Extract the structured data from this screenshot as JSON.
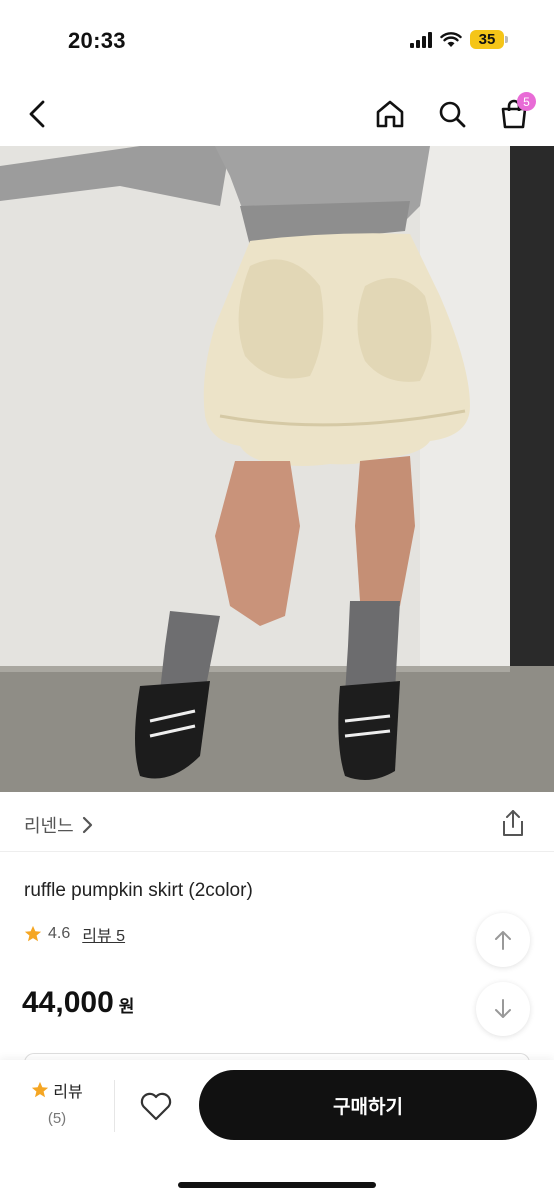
{
  "status_bar": {
    "time": "20:33",
    "battery": "35",
    "icons": [
      "signal-icon",
      "wifi-icon",
      "battery-icon"
    ]
  },
  "nav": {
    "icons": [
      "chevron-left-icon",
      "home-icon",
      "search-icon",
      "shopping-bag-icon"
    ],
    "cart_badge": "5"
  },
  "product": {
    "image_description_icon": "product-photo",
    "brand": "리넨느",
    "title": "ruffle pumpkin skirt (2color)",
    "rating": "4.6",
    "review_link": "리뷰 5",
    "price": "44,000",
    "price_unit": "원"
  },
  "bottom_bar": {
    "review_label": "리뷰",
    "review_count": "(5)",
    "buy_label": "구매하기",
    "colors": {
      "accent_star": "#f5a623",
      "buy_button": "#111111",
      "badge": "#e86bd6"
    }
  }
}
